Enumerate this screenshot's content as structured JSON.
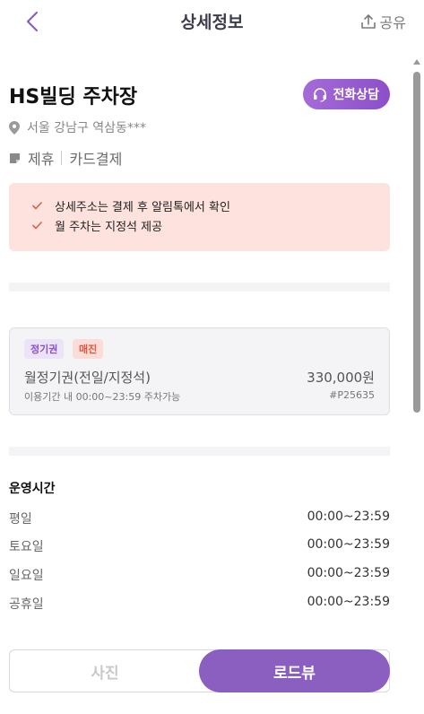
{
  "header": {
    "title": "상세정보",
    "share_label": "공유",
    "back_icon": "chevron-left-icon",
    "share_icon": "share-icon"
  },
  "lot": {
    "name": "HS빌딩 주차장",
    "call_label": "전화상담",
    "address": "서울 강남구 역삼동***",
    "tags": [
      "제휴",
      "카드결제"
    ]
  },
  "notice": {
    "items": [
      "상세주소는 결제 후 알림톡에서 확인",
      "월 주차는 지정석 제공"
    ]
  },
  "pass": {
    "badge_type": "정기권",
    "badge_status": "매진",
    "name": "월정기권(전일/지정석)",
    "price": "330,000원",
    "period": "이용기간 내 00:00~23:59 주차가능",
    "code": "#P25635"
  },
  "hours": {
    "title": "운영시간",
    "rows": [
      {
        "day": "평일",
        "time": "00:00~23:59"
      },
      {
        "day": "토요일",
        "time": "00:00~23:59"
      },
      {
        "day": "일요일",
        "time": "00:00~23:59"
      },
      {
        "day": "공휴일",
        "time": "00:00~23:59"
      }
    ]
  },
  "view_toggle": {
    "photo_label": "사진",
    "road_label": "로드뷰",
    "selected": "로드뷰"
  },
  "colors": {
    "accent": "#8b5fbf",
    "notice_bg": "#fde2dd",
    "sold_out": "#e0563f"
  }
}
